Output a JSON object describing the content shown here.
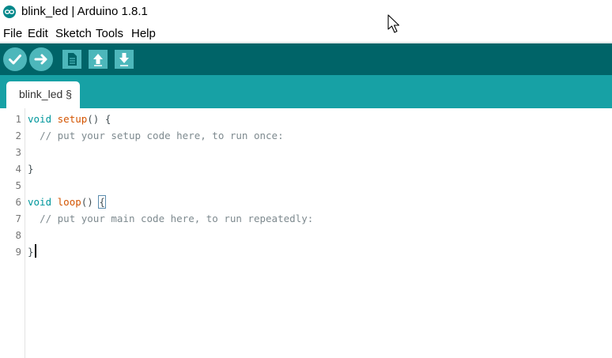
{
  "window": {
    "title": "blink_led | Arduino 1.8.1",
    "icon": "arduino-infinity-icon"
  },
  "menu": {
    "items": [
      "File",
      "Edit",
      "Sketch",
      "Tools",
      "Help"
    ]
  },
  "toolbar": {
    "buttons": [
      {
        "name": "verify",
        "icon": "checkmark-icon"
      },
      {
        "name": "upload",
        "icon": "arrow-right-icon"
      },
      {
        "name": "new",
        "icon": "new-file-icon"
      },
      {
        "name": "open",
        "icon": "arrow-up-icon"
      },
      {
        "name": "save",
        "icon": "arrow-down-icon"
      }
    ]
  },
  "tabs": [
    {
      "label": "blink_led §"
    }
  ],
  "editor": {
    "lines": [
      {
        "number": "1",
        "tokens": [
          {
            "t": "kw",
            "v": "void"
          },
          {
            "t": "plain",
            "v": " "
          },
          {
            "t": "fn",
            "v": "setup"
          },
          {
            "t": "plain",
            "v": "() {"
          }
        ]
      },
      {
        "number": "2",
        "tokens": [
          {
            "t": "plain",
            "v": "  "
          },
          {
            "t": "cm",
            "v": "// put your setup code here, to run once:"
          }
        ]
      },
      {
        "number": "3",
        "tokens": []
      },
      {
        "number": "4",
        "tokens": [
          {
            "t": "plain",
            "v": "}"
          }
        ]
      },
      {
        "number": "5",
        "tokens": []
      },
      {
        "number": "6",
        "tokens": [
          {
            "t": "kw",
            "v": "void"
          },
          {
            "t": "plain",
            "v": " "
          },
          {
            "t": "fn",
            "v": "loop"
          },
          {
            "t": "plain",
            "v": "() "
          },
          {
            "t": "match",
            "v": "{"
          }
        ]
      },
      {
        "number": "7",
        "tokens": [
          {
            "t": "plain",
            "v": "  "
          },
          {
            "t": "cm",
            "v": "// put your main code here, to run repeatedly:"
          }
        ]
      },
      {
        "number": "8",
        "tokens": []
      },
      {
        "number": "9",
        "tokens": [
          {
            "t": "plain",
            "v": "}"
          }
        ]
      }
    ]
  },
  "colors": {
    "toolbar_bg": "#006468",
    "tabbar_bg": "#17a1a5",
    "button_bg": "#4db7bb",
    "keyword": "#00979c",
    "function": "#d35400",
    "comment": "#7e8a8f"
  }
}
